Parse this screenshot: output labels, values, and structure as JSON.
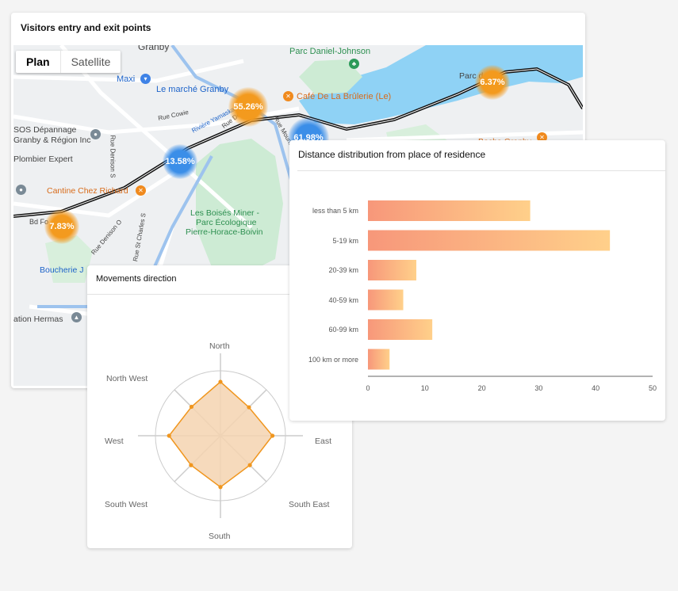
{
  "map_card": {
    "title": "Visitors entry and exit points",
    "tabs": [
      "Plan",
      "Satellite"
    ],
    "active_tab": "Plan",
    "labels": {
      "granby": "Granby",
      "parc_daniel": "Parc Daniel-Johnson",
      "maxi": "Maxi",
      "marche": "Le marché Granby",
      "cafe": "Café De La Brûlerie (Le)",
      "parc_ville": "Parc de la",
      "sos": "SOS Dépannage",
      "sos2": "Granby & Région Inc",
      "plombier": "Plombier Expert",
      "cantine": "Cantine Chez Richard",
      "bd": "Bd Fo",
      "boisés1": "Les Boisés Miner -",
      "boisés2": "Parc Écologique",
      "boisés3": "Pierre-Horace-Boivin",
      "boucherie": "Boucherie J",
      "hermas": "ation Hermas",
      "bocha": "Bocha Granby",
      "rue_cowie": "Rue Cowie",
      "riviere": "Rivière Yamaska",
      "rue_denison": "Rue Denison O",
      "rue_denison_s": "Rue Denison S",
      "rue_st_charles": "Rue St Charles S",
      "rue_mountain": "Rue Mountain",
      "rue_denison_o2": "Rue Denison O"
    },
    "hotspots": [
      {
        "label": "55.26%",
        "color": "orange"
      },
      {
        "label": "61.98%",
        "color": "blue"
      },
      {
        "label": "13.58%",
        "color": "blue"
      },
      {
        "label": "7.83%",
        "color": "orange"
      },
      {
        "label": "6.37%",
        "color": "orange"
      }
    ]
  },
  "movements_card": {
    "title": "Movements direction",
    "directions": [
      "North",
      "North East",
      "East",
      "South East",
      "South",
      "South West",
      "West",
      "North West"
    ],
    "chart_data": {
      "type": "radar",
      "axes": [
        "North",
        "North East",
        "East",
        "South East",
        "South",
        "South West",
        "West",
        "North West"
      ],
      "values": [
        0.83,
        0.62,
        0.8,
        0.64,
        0.79,
        0.64,
        0.79,
        0.63
      ],
      "max": 1,
      "fill_color": "#f5d3b0",
      "line_color": "#f0961e"
    }
  },
  "distance_card": {
    "title": "Distance distribution from place of residence",
    "chart_data": {
      "type": "bar",
      "orientation": "horizontal",
      "categories": [
        "less than 5 km",
        "5-19 km",
        "20-39 km",
        "40-59 km",
        "60-99 km",
        "100 km or more"
      ],
      "values": [
        28.5,
        42.5,
        8.5,
        6.2,
        11.3,
        3.8
      ],
      "xlim": [
        0,
        50
      ],
      "xticks": [
        "0",
        "10",
        "20",
        "30",
        "40",
        "50"
      ],
      "gradient_start": "#f7977a",
      "gradient_end": "#ffd08a"
    }
  }
}
